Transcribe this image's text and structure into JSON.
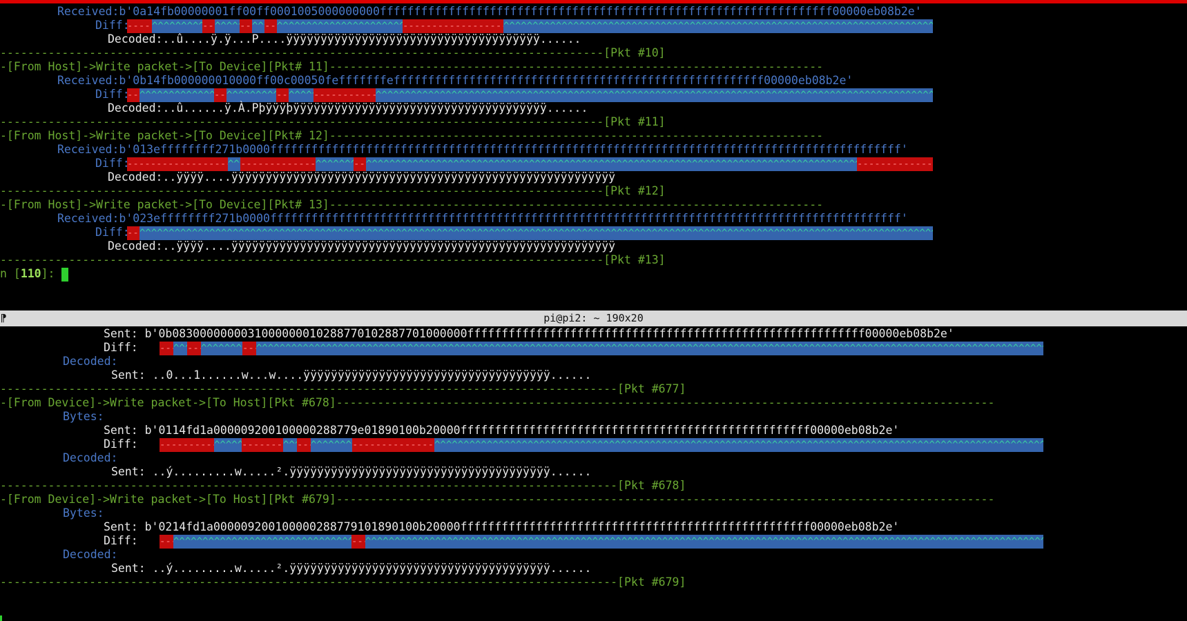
{
  "top_pane": {
    "blocks": [
      {
        "received_label": "Received:",
        "received_hex": "b'0a14fb00000001ff00ff0001005000000000ffffffffffffffffffffffffffffffffffffffffffffffffffffffffffffffffff00000eb08b2e'",
        "diff_label": "Diff:",
        "decoded_label": "Decoded:",
        "decoded_value": "..û....ÿ.ÿ...P....ÿÿÿÿÿÿÿÿÿÿÿÿÿÿÿÿÿÿÿÿÿÿÿÿÿÿÿÿÿÿÿÿÿÿÿÿÿ......",
        "separator": "----------------------------------------------------------------------------------------[Pkt #10]"
      },
      {
        "header": "-[From Host]->Write packet->[To Device][Pkt# 11]------------------------------------------------------------------------",
        "received_label": "Received:",
        "received_hex": "b'0b14fb000000010000ff00c00050fefffffffeffffffffffffffffffffffffffffffffffffffffffffffffffffff00000eb08b2e'",
        "diff_label": "Diff:",
        "decoded_label": "Decoded:",
        "decoded_value": "..û......ÿ.À.Pþÿÿÿþÿÿÿÿÿÿÿÿÿÿÿÿÿÿÿÿÿÿÿÿÿÿÿÿÿÿÿÿÿÿÿÿÿÿÿÿÿ......",
        "separator": "----------------------------------------------------------------------------------------[Pkt #11]"
      },
      {
        "header": "-[From Host]->Write packet->[To Device][Pkt# 12]------------------------------------------------------------------------",
        "received_label": "Received:",
        "received_hex": "b'013effffffff271b0000ffffffffffffffffffffffffffffffffffffffffffffffffffffffffffffffffffffffffffffffffffffffffffff'",
        "diff_label": "Diff:",
        "decoded_label": "Decoded:",
        "decoded_value": "..ÿÿÿÿ....ÿÿÿÿÿÿÿÿÿÿÿÿÿÿÿÿÿÿÿÿÿÿÿÿÿÿÿÿÿÿÿÿÿÿÿÿÿÿÿÿÿÿÿÿÿÿÿÿÿÿÿÿÿÿÿÿ",
        "separator": "----------------------------------------------------------------------------------------[Pkt #12]"
      },
      {
        "header": "-[From Host]->Write packet->[To Device][Pkt# 13]------------------------------------------------------------------------",
        "received_label": "Received:",
        "received_hex": "b'023effffffff271b0000ffffffffffffffffffffffffffffffffffffffffffffffffffffffffffffffffffffffffffffffffffffffffffff'",
        "diff_label": "Diff:",
        "decoded_label": "Decoded:",
        "decoded_value": "..ÿÿÿÿ....ÿÿÿÿÿÿÿÿÿÿÿÿÿÿÿÿÿÿÿÿÿÿÿÿÿÿÿÿÿÿÿÿÿÿÿÿÿÿÿÿÿÿÿÿÿÿÿÿÿÿÿÿÿÿÿÿ",
        "separator": "----------------------------------------------------------------------------------------[Pkt #13]"
      }
    ],
    "prompt": {
      "prefix": "n [",
      "number": "110",
      "suffix": "]: "
    }
  },
  "divider": {
    "title": "pi@pi2: ~ 190x20"
  },
  "bottom_pane": {
    "first_block": {
      "sent_label": "Sent:",
      "sent_hex": "b'0b0830000000031000000010288770102887701000000ffffffffffffffffffffffffffffffffffffffffffffffffffffffffff00000eb08b2e'",
      "diff_label": "Diff:",
      "decoded_label": "Decoded:",
      "decoded_sent_label": "Sent:",
      "decoded_value": "..0...1......w...w....ÿÿÿÿÿÿÿÿÿÿÿÿÿÿÿÿÿÿÿÿÿÿÿÿÿÿÿÿÿÿÿÿÿÿÿÿ......",
      "separator": "------------------------------------------------------------------------------------------[Pkt #677]"
    },
    "blocks": [
      {
        "header": "-[From Device]->Write packet->[To Host][Pkt #678]------------------------------------------------------------------------------------------------",
        "bytes_label": "Bytes:",
        "sent_label": "Sent:",
        "sent_hex": "b'0114fd1a000009200100000288779e01890100b20000fffffffffffffffffffffffffffffffffffffffffffffffffff00000eb08b2e'",
        "diff_label": "Diff:",
        "decoded_label": "Decoded:",
        "decoded_sent_label": "Sent:",
        "decoded_value": "..ý.........w.....².ÿÿÿÿÿÿÿÿÿÿÿÿÿÿÿÿÿÿÿÿÿÿÿÿÿÿÿÿÿÿÿÿÿÿÿÿÿÿ......",
        "separator": "------------------------------------------------------------------------------------------[Pkt #678]"
      },
      {
        "header": "-[From Device]->Write packet->[To Host][Pkt #679]------------------------------------------------------------------------------------------------",
        "bytes_label": "Bytes:",
        "sent_label": "Sent:",
        "sent_hex": "b'0214fd1a000009200100000288779101890100b20000fffffffffffffffffffffffffffffffffffffffffffffffffff00000eb08b2e'",
        "diff_label": "Diff:",
        "decoded_label": "Decoded:",
        "decoded_sent_label": "Sent:",
        "decoded_value": "..ý.........w.....².ÿÿÿÿÿÿÿÿÿÿÿÿÿÿÿÿÿÿÿÿÿÿÿÿÿÿÿÿÿÿÿÿÿÿÿÿÿÿ......",
        "separator": "------------------------------------------------------------------------------------------[Pkt #679]"
      }
    ]
  },
  "diff_bars": [
    {
      "id": "top-0",
      "segments": [
        [
          "diff",
          4
        ],
        [
          "same",
          8
        ],
        [
          "diff",
          2
        ],
        [
          "same",
          4
        ],
        [
          "diff",
          2
        ],
        [
          "same",
          2
        ],
        [
          "diff",
          2
        ],
        [
          "same",
          20
        ],
        [
          "diff",
          16
        ],
        [
          "same",
          68
        ]
      ]
    },
    {
      "id": "top-1",
      "segments": [
        [
          "diff",
          2
        ],
        [
          "same",
          12
        ],
        [
          "diff",
          2
        ],
        [
          "same",
          8
        ],
        [
          "diff",
          2
        ],
        [
          "same",
          4
        ],
        [
          "diff",
          10
        ],
        [
          "same",
          90
        ]
      ]
    },
    {
      "id": "top-2",
      "segments": [
        [
          "diff",
          16
        ],
        [
          "same",
          2
        ],
        [
          "diff",
          12
        ],
        [
          "same",
          6
        ],
        [
          "diff",
          2
        ],
        [
          "same",
          78
        ],
        [
          "diff",
          12
        ]
      ]
    },
    {
      "id": "top-3",
      "segments": [
        [
          "diff",
          2
        ],
        [
          "same",
          126
        ]
      ]
    },
    {
      "id": "bot-0",
      "segments": [
        [
          "diff",
          2
        ],
        [
          "same",
          2
        ],
        [
          "diff",
          2
        ],
        [
          "same",
          6
        ],
        [
          "diff",
          2
        ],
        [
          "same",
          115
        ]
      ]
    },
    {
      "id": "bot-1",
      "segments": [
        [
          "diff",
          8
        ],
        [
          "same",
          4
        ],
        [
          "diff",
          6
        ],
        [
          "same",
          2
        ],
        [
          "diff",
          2
        ],
        [
          "same",
          6
        ],
        [
          "diff",
          12
        ],
        [
          "same",
          89
        ]
      ]
    },
    {
      "id": "bot-2",
      "segments": [
        [
          "diff",
          2
        ],
        [
          "same",
          26
        ],
        [
          "diff",
          2
        ],
        [
          "same",
          99
        ]
      ]
    }
  ],
  "diff_chars": {
    "same": "^",
    "diff": "-"
  },
  "colors": {
    "diff_same_bg": "#3565ad",
    "diff_changed_bg": "#c40d0d",
    "label_blue": "#4a78c8",
    "separator_green": "#6aa832",
    "cursor_green": "#2fd02f"
  }
}
